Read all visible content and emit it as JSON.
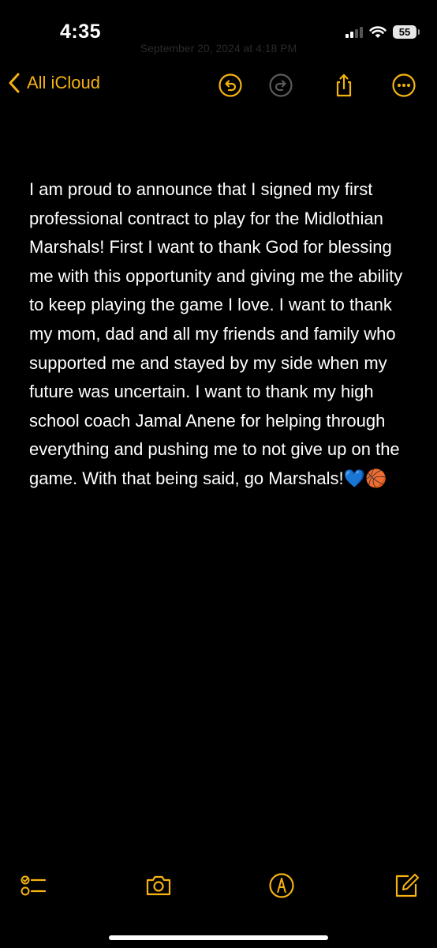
{
  "status_bar": {
    "time": "4:35",
    "battery": "55",
    "signal_icon": "cellular-signal-icon",
    "wifi_icon": "wifi-icon"
  },
  "header": {
    "back_label": "All iCloud",
    "date_text": "September 20, 2024 at 4:18 PM"
  },
  "colors": {
    "accent": "#f5b312",
    "background": "#000000",
    "text": "#ffffff"
  },
  "note": {
    "text": "I am proud to announce that I signed my first professional contract to play for the Midlothian Marshals! First I want to thank God for blessing me with this opportunity and giving me the ability to keep playing the game I love. I want to thank my mom, dad and all my friends and family who supported me and stayed by my side when my future was uncertain. I want to thank my high school coach Jamal Anene for helping through everything and pushing me to not give up on the game. With that being said, go Marshals!💙🏀"
  },
  "toolbar": {
    "checklist": "checklist-icon",
    "camera": "camera-icon",
    "markup": "markup-pen-icon",
    "compose": "compose-icon"
  }
}
